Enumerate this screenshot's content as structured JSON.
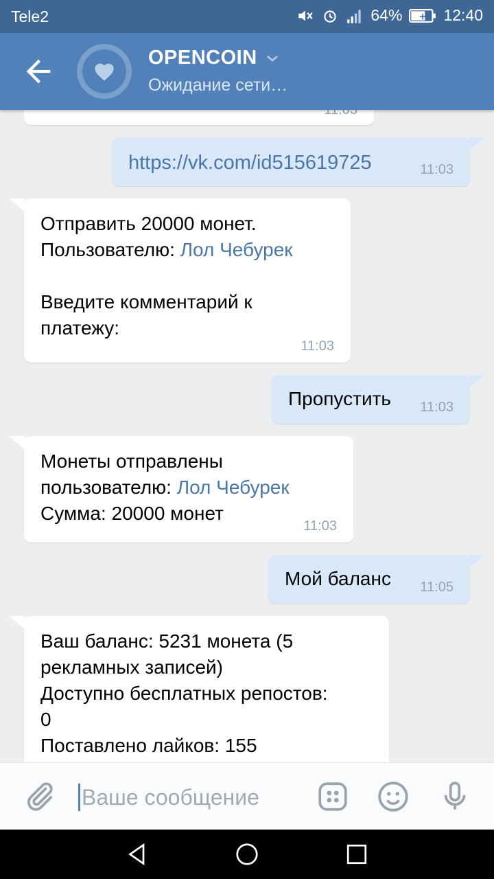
{
  "status": {
    "carrier": "Tele2",
    "battery": "64%",
    "time": "12:40"
  },
  "header": {
    "title": "OPENCOIN",
    "subtitle": "Ожидание сети…"
  },
  "messages": {
    "m0": {
      "time": "11:03"
    },
    "m1": {
      "text": "https://vk.com/id515619725",
      "time": "11:03"
    },
    "m2": {
      "line1": "Отправить 20000 монет.",
      "line2_prefix": "Пользователю: ",
      "line2_link": "Лол Чебурек",
      "line3": "Введите комментарий к",
      "line4": "платежу:",
      "time": "11:03"
    },
    "m3": {
      "text": "Пропустить",
      "time": "11:03"
    },
    "m4": {
      "line1": "Монеты отправлены",
      "line2_prefix": "пользователю: ",
      "line2_link": "Лол Чебурек",
      "line3": "Сумма: 20000 монет",
      "time": "11:03"
    },
    "m5": {
      "text": "Мой баланс",
      "time": "11:05"
    },
    "m6": {
      "line1": "Ваш баланс: 5231 монета (5",
      "line2": "рекламных записей)",
      "line3": "Доступно бесплатных репостов:",
      "line4": "0",
      "line5": "Поставлено лайков: 155"
    }
  },
  "composer": {
    "placeholder": "Ваше сообщение"
  },
  "icons": {
    "back": "arrow-left-icon",
    "attach": "paperclip-icon",
    "apps": "keyboard-apps-icon",
    "emoji": "smile-icon",
    "mic": "microphone-icon"
  }
}
